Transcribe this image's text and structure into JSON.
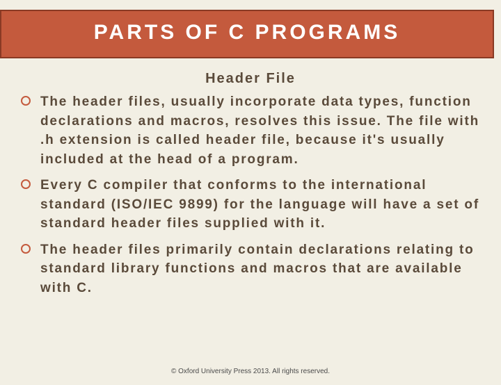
{
  "slide": {
    "title": "PARTS OF C PROGRAMS",
    "subtitle": "Header File",
    "bullets": [
      "The header files, usually incorporate data types, function declarations and macros, resolves this issue. The file with .h extension is called header file, because it's usually included at the head of a program.",
      "Every C compiler that conforms to the international standard (ISO/IEC 9899) for the language will have a set of standard header files supplied with it.",
      "The header files primarily contain declarations relating to standard library functions and macros that are available with C."
    ],
    "footer": "© Oxford University Press 2013. All rights reserved."
  }
}
